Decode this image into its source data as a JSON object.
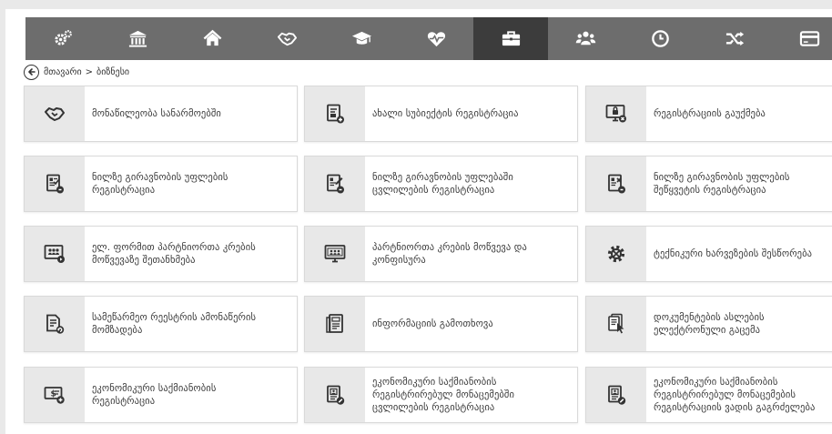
{
  "topnav": {
    "items": [
      {
        "icon": "gears-icon",
        "active": false
      },
      {
        "icon": "institution-icon",
        "active": false
      },
      {
        "icon": "home-icon",
        "active": false
      },
      {
        "icon": "handshake-icon",
        "active": false
      },
      {
        "icon": "graduation-cap-icon",
        "active": false
      },
      {
        "icon": "heartbeat-icon",
        "active": false
      },
      {
        "icon": "briefcase-icon",
        "active": true
      },
      {
        "icon": "users-icon",
        "active": false
      },
      {
        "icon": "clock-icon",
        "active": false
      },
      {
        "icon": "shuffle-icon",
        "active": false
      },
      {
        "icon": "credit-card-icon",
        "active": false
      }
    ],
    "colors": {
      "bar": "#6d6d6d",
      "active": "#3c3c3c",
      "icon": "#ffffff"
    }
  },
  "breadcrumb": {
    "home": "მთავარი",
    "separator": ">",
    "current": "ბიზნესი"
  },
  "cards": [
    {
      "label": "მონაწილეობა სანარმოებში",
      "icon": "handshake-icon"
    },
    {
      "label": "ახალი სუბიექტის რეგისტრაცია",
      "icon": "document-add-icon"
    },
    {
      "label": "რეგისტრაციის გაუქმება",
      "icon": "monitor-lock-icon"
    },
    {
      "label": "ნილზე გირავნობის უფლების\nრეგისტრაცია",
      "icon": "document-check-icon"
    },
    {
      "label": "ნილზე გირავნობის უფლებაში\nცვლილების რეგისტრაცია",
      "icon": "document-edit-icon"
    },
    {
      "label": "ნილზე გირავნობის უფლების\nშეწყვეტის რეგისტრაცია",
      "icon": "document-cancel-icon"
    },
    {
      "label": "ელ. ფორმით პარტნიორთა კრების\nმოწვევაზე შეთანხმება",
      "icon": "presentation-icon"
    },
    {
      "label": "პარტნიორთა კრების მოწვევა და\nკონფისურა",
      "icon": "meeting-screen-icon"
    },
    {
      "label": "ტექნიკური ხარვეზების შესწორება",
      "icon": "gear-tools-icon"
    },
    {
      "label": "სამეწარმეო რეესტრის ამონაწერის\nმომზადება",
      "icon": "document-refresh-icon"
    },
    {
      "label": "ინფორმაციის გამოთხოვა",
      "icon": "document-list-icon"
    },
    {
      "label": "დოკუმენტების ასლების\nელექტრონული გაცემა",
      "icon": "document-cursor-icon"
    },
    {
      "label": "ეკონომიკური საქმიანობის\nრეგისტრაცია",
      "icon": "money-add-icon"
    },
    {
      "label": "ეკონომიკური საქმიანობის\nრეგისტრირებულ მონაცემებში\nცვლილების რეგისტრაცია",
      "icon": "document-pencil-icon"
    },
    {
      "label": "ეკონომიკური საქმიანობის\nრეგისტრირებულ მონაცემების\nრეგისტრაციის ვადის გაგრძელება",
      "icon": "document-pencil-icon"
    }
  ]
}
